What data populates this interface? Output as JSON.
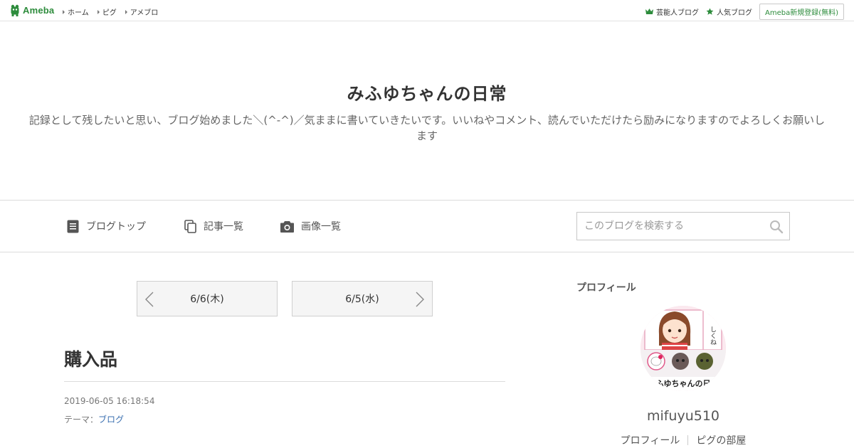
{
  "topbar": {
    "logo_text": "Ameba",
    "nav": [
      {
        "label": "ホーム"
      },
      {
        "label": "ピグ"
      },
      {
        "label": "アメブロ"
      }
    ],
    "right_links": [
      {
        "label": "芸能人ブログ",
        "icon": "crown-icon"
      },
      {
        "label": "人気ブログ",
        "icon": "star-icon"
      }
    ],
    "register_label": "Ameba新規登録(無料)",
    "accent_color": "#2d8c3c"
  },
  "blog": {
    "title": "みふゆちゃんの日常",
    "description": "記録として残したいと思い、ブログ始めました＼(^-^)／気ままに書いていきたいです。いいねやコメント、読んでいただけたら励みになりますのでよろしくお願いします"
  },
  "blog_nav": {
    "items": [
      {
        "label": "ブログトップ",
        "icon": "document-icon"
      },
      {
        "label": "記事一覧",
        "icon": "copy-icon"
      },
      {
        "label": "画像一覧",
        "icon": "camera-icon"
      }
    ],
    "search_placeholder": "このブログを検索する"
  },
  "pager": {
    "prev_label": "6/6(木)",
    "next_label": "6/5(水)"
  },
  "entry": {
    "title": "購入品",
    "date": "2019-06-05 16:18:54",
    "theme_prefix": "テーマ：",
    "theme_link": "ブログ"
  },
  "sidebar": {
    "heading": "プロフィール",
    "avatar_caption": "ふゆちゃんの日",
    "avatar_side_text": "しくね",
    "username": "mifuyu510",
    "links": [
      {
        "label": "プロフィール"
      },
      {
        "label": "ピグの部屋"
      }
    ]
  }
}
